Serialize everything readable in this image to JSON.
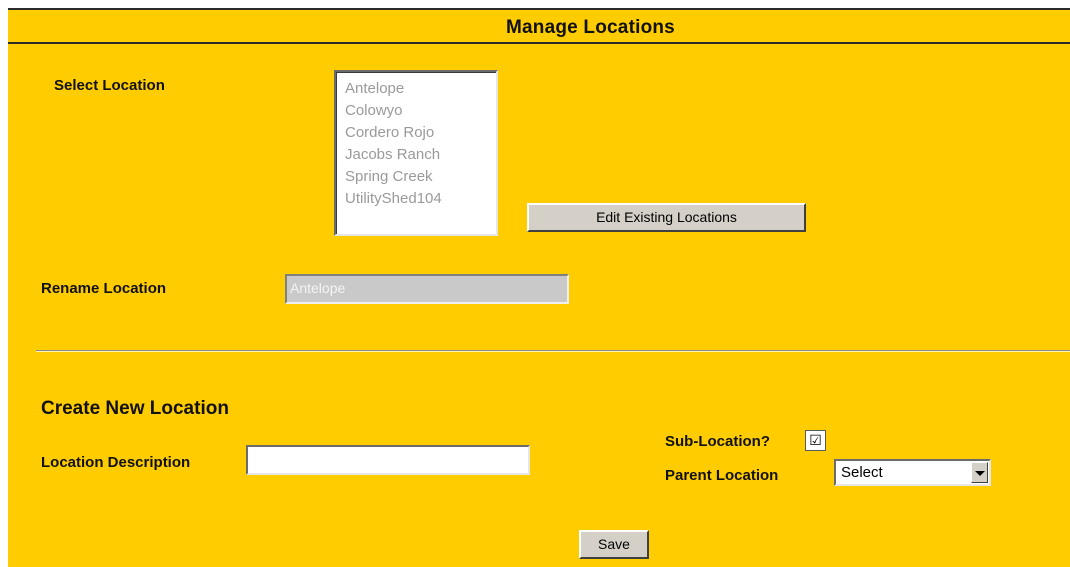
{
  "header": {
    "title": "Manage Locations"
  },
  "select_location": {
    "label": "Select Location",
    "options": [
      "Antelope",
      "Colowyo",
      "Cordero Rojo",
      "Jacobs Ranch",
      "Spring Creek",
      "UtilityShed104"
    ],
    "edit_button_label": "Edit Existing Locations"
  },
  "rename_location": {
    "label": "Rename Location",
    "value": "Antelope"
  },
  "create_new": {
    "title": "Create New Location",
    "description_label": "Location Description",
    "description_value": "",
    "sub_location_label": "Sub-Location?",
    "sub_location_checked": true,
    "checkbox_glyph": "☑",
    "parent_location_label": "Parent Location",
    "parent_location_value": "Select",
    "save_label": "Save"
  },
  "colors": {
    "background": "#ffcc00",
    "rule": "#2b2b2b"
  }
}
